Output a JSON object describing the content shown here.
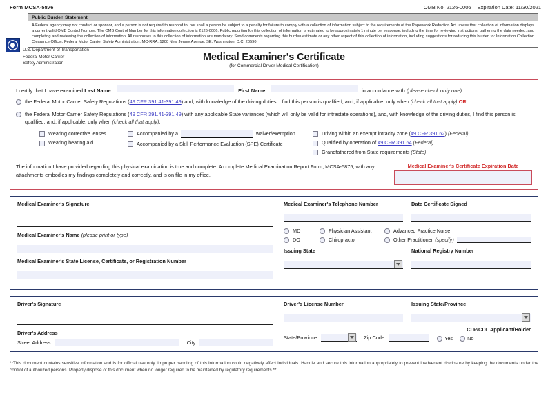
{
  "header": {
    "form_number": "Form MCSA-5876",
    "omb_number": "OMB No. 2126-0006",
    "expiration": "Expiration Date: 11/30/2021"
  },
  "burden": {
    "heading": "Public Burden Statement",
    "body": "A Federal agency may not conduct or sponsor, and a person is not required to respond to, nor shall a person be subject to a penalty for failure to comply with a collection of information subject to the requirements of the Paperwork Reduction Act unless that collection of information displays a current valid OMB Control Number. The OMB Control Number for this information collection is 2126-0006. Public reporting for this collection of information is estimated to be approximately 1 minute per response, including the time for reviewing instructions, gathering the data needed, and completing and reviewing the collection of information. All responses to this collection of information are mandatory. Send comments regarding this burden estimate or any other aspect of this collection of information, including suggestions for reducing this burden to: Information Collection Clearance Officer, Federal Motor Carrier Safety Administration, MC-RRA, 1200 New Jersey Avenue, SE, Washington, D.C. 20590."
  },
  "agency": {
    "line1": "U.S. Department of Transportation",
    "line2": "Federal Motor Carrier",
    "line3": "Safety Administration",
    "logo_icon": "dot-triskelion-icon"
  },
  "title": {
    "main": "Medical Examiner's Certificate",
    "sub": "(for Commercial Driver Medical Certification)"
  },
  "certify": {
    "intro": "I certify that I have examined",
    "last_name_label": "Last Name:",
    "last_name_value": "",
    "first_name_label": "First Name:",
    "first_name_value": "",
    "accordance": "in accordance with",
    "check_one": "(please check only one)",
    "colon": ":",
    "option1": {
      "pre": "the Federal Motor Carrier Safety Regulations (",
      "link": "49 CFR 391.41-391.49",
      "post": ") and, with knowledge of the driving duties, I find this person is qualified, and, if applicable, only when ",
      "check_all": "(check all that apply)",
      "or": "OR"
    },
    "option2": {
      "pre": "the Federal Motor Carrier Safety Regulations (",
      "link": "49 CFR 391.41-391.49",
      "post": ") with any applicable State variances (which will only be valid for intrastate operations), and, with knowledge of the driving duties, I find this person is qualified, and, if applicable, only when ",
      "check_all": "(check all that apply)",
      "colon": ":"
    },
    "conditions_col1": [
      {
        "label": "Wearing corrective lenses"
      },
      {
        "label": "Wearing hearing aid"
      }
    ],
    "conditions_col2": [
      {
        "pre": "Accompanied by a",
        "field_value": "",
        "post": "waiver/exemption"
      },
      {
        "pre": "Accompanied by a Skill Performance Evaluation (SPE) Certificate",
        "field_value": null,
        "post": ""
      }
    ],
    "conditions_col3": [
      {
        "pre": "Driving within an exempt intracity zone (",
        "link": "49 CFR 391.62",
        "post": ") ",
        "note": "(Federal)"
      },
      {
        "pre": "Qualified by operation of ",
        "link": "49 CFR 391.64",
        "post": " ",
        "note": "(Federal)"
      },
      {
        "pre": "Grandfathered from State requirements ",
        "link": "",
        "post": "",
        "note": "(State)"
      }
    ],
    "attestation": "The information I have provided regarding this physical examination is true and complete. A complete Medical Examination Report Form, MCSA-5875, with any attachments embodies my findings completely and correctly, and is on file in my office.",
    "expiration_label": "Medical Examiner's Certificate Expiration Date",
    "expiration_value": ""
  },
  "examiner": {
    "signature_label": "Medical Examiner's Signature",
    "signature_value": "",
    "name_label": "Medical Examiner's Name",
    "name_label_hint": "(please print or type)",
    "name_value": "",
    "license_label": "Medical Examiner's State License, Certificate, or Registration Number",
    "license_value": "",
    "phone_label": "Medical Examiner's Telephone Number",
    "phone_value": "",
    "date_signed_label": "Date Certificate Signed",
    "date_signed_value": "",
    "practitioner_col1": [
      "MD",
      "DO"
    ],
    "practitioner_col2": [
      "Physician Assistant",
      "Chiropractor"
    ],
    "practitioner_col3": [
      "Advanced Practice Nurse",
      "Other Practitioner"
    ],
    "other_specify": "(specify)",
    "other_specify_value": "",
    "issuing_state_label": "Issuing State",
    "issuing_state_value": "",
    "registry_label": "National Registry Number",
    "registry_value": ""
  },
  "driver": {
    "signature_label": "Driver's Signature",
    "signature_value": "",
    "address_label": "Driver's Address",
    "street_label": "Street Address:",
    "street_value": "",
    "city_label": "City:",
    "city_value": "",
    "state_label": "State/Province:",
    "state_value": "",
    "zip_label": "Zip Code:",
    "zip_value": "",
    "license_label": "Driver's License Number",
    "license_value": "",
    "issuing_state_label": "Issuing State/Province",
    "issuing_state_value": "",
    "clp_label": "CLP/CDL Applicant/Holder",
    "clp_yes": "Yes",
    "clp_no": "No"
  },
  "footer": {
    "text": "**This document contains sensitive information and is for official use only.  Improper handling of this information could negatively affect individuals.  Handle and secure this information appropriately to prevent inadvertent disclosure by keeping the documents under the control of authorized persons.  Properly dispose of this document when no longer required to be maintained by regulatory requirements.**"
  },
  "colors": {
    "red_accent": "#d12b2b",
    "red_border": "#c94b5a",
    "blue_border": "#2b3a6b",
    "link_blue": "#3b3bc4",
    "field_fill": "#eef0fa",
    "logo_blue": "#173a93"
  }
}
